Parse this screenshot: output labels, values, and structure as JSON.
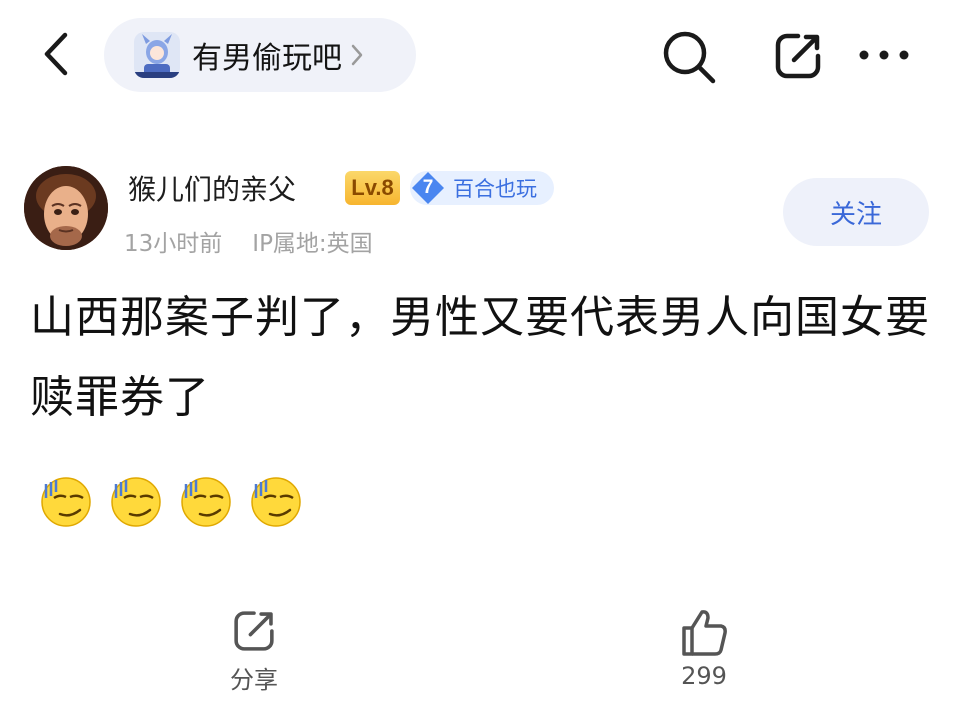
{
  "header": {
    "forum_name": "有男偷玩吧"
  },
  "author": {
    "name": "猴儿们的亲父",
    "level": "Lv.8",
    "fan_level": "7",
    "fan_badge": "百合也玩",
    "time": "13小时前",
    "ip": "IP属地:英国"
  },
  "follow_label": "关注",
  "post": {
    "text": "山西那案子判了，男性又要代表男人向国女要赎罪券了",
    "emojis": [
      "smirk-face",
      "smirk-face",
      "smirk-face",
      "smirk-face"
    ]
  },
  "actions": {
    "share_label": "分享",
    "like_count": "299"
  },
  "colors": {
    "accent_blue": "#3a68d8",
    "chip_bg": "#f0f2f9",
    "level_badge": "#f7b52f"
  }
}
